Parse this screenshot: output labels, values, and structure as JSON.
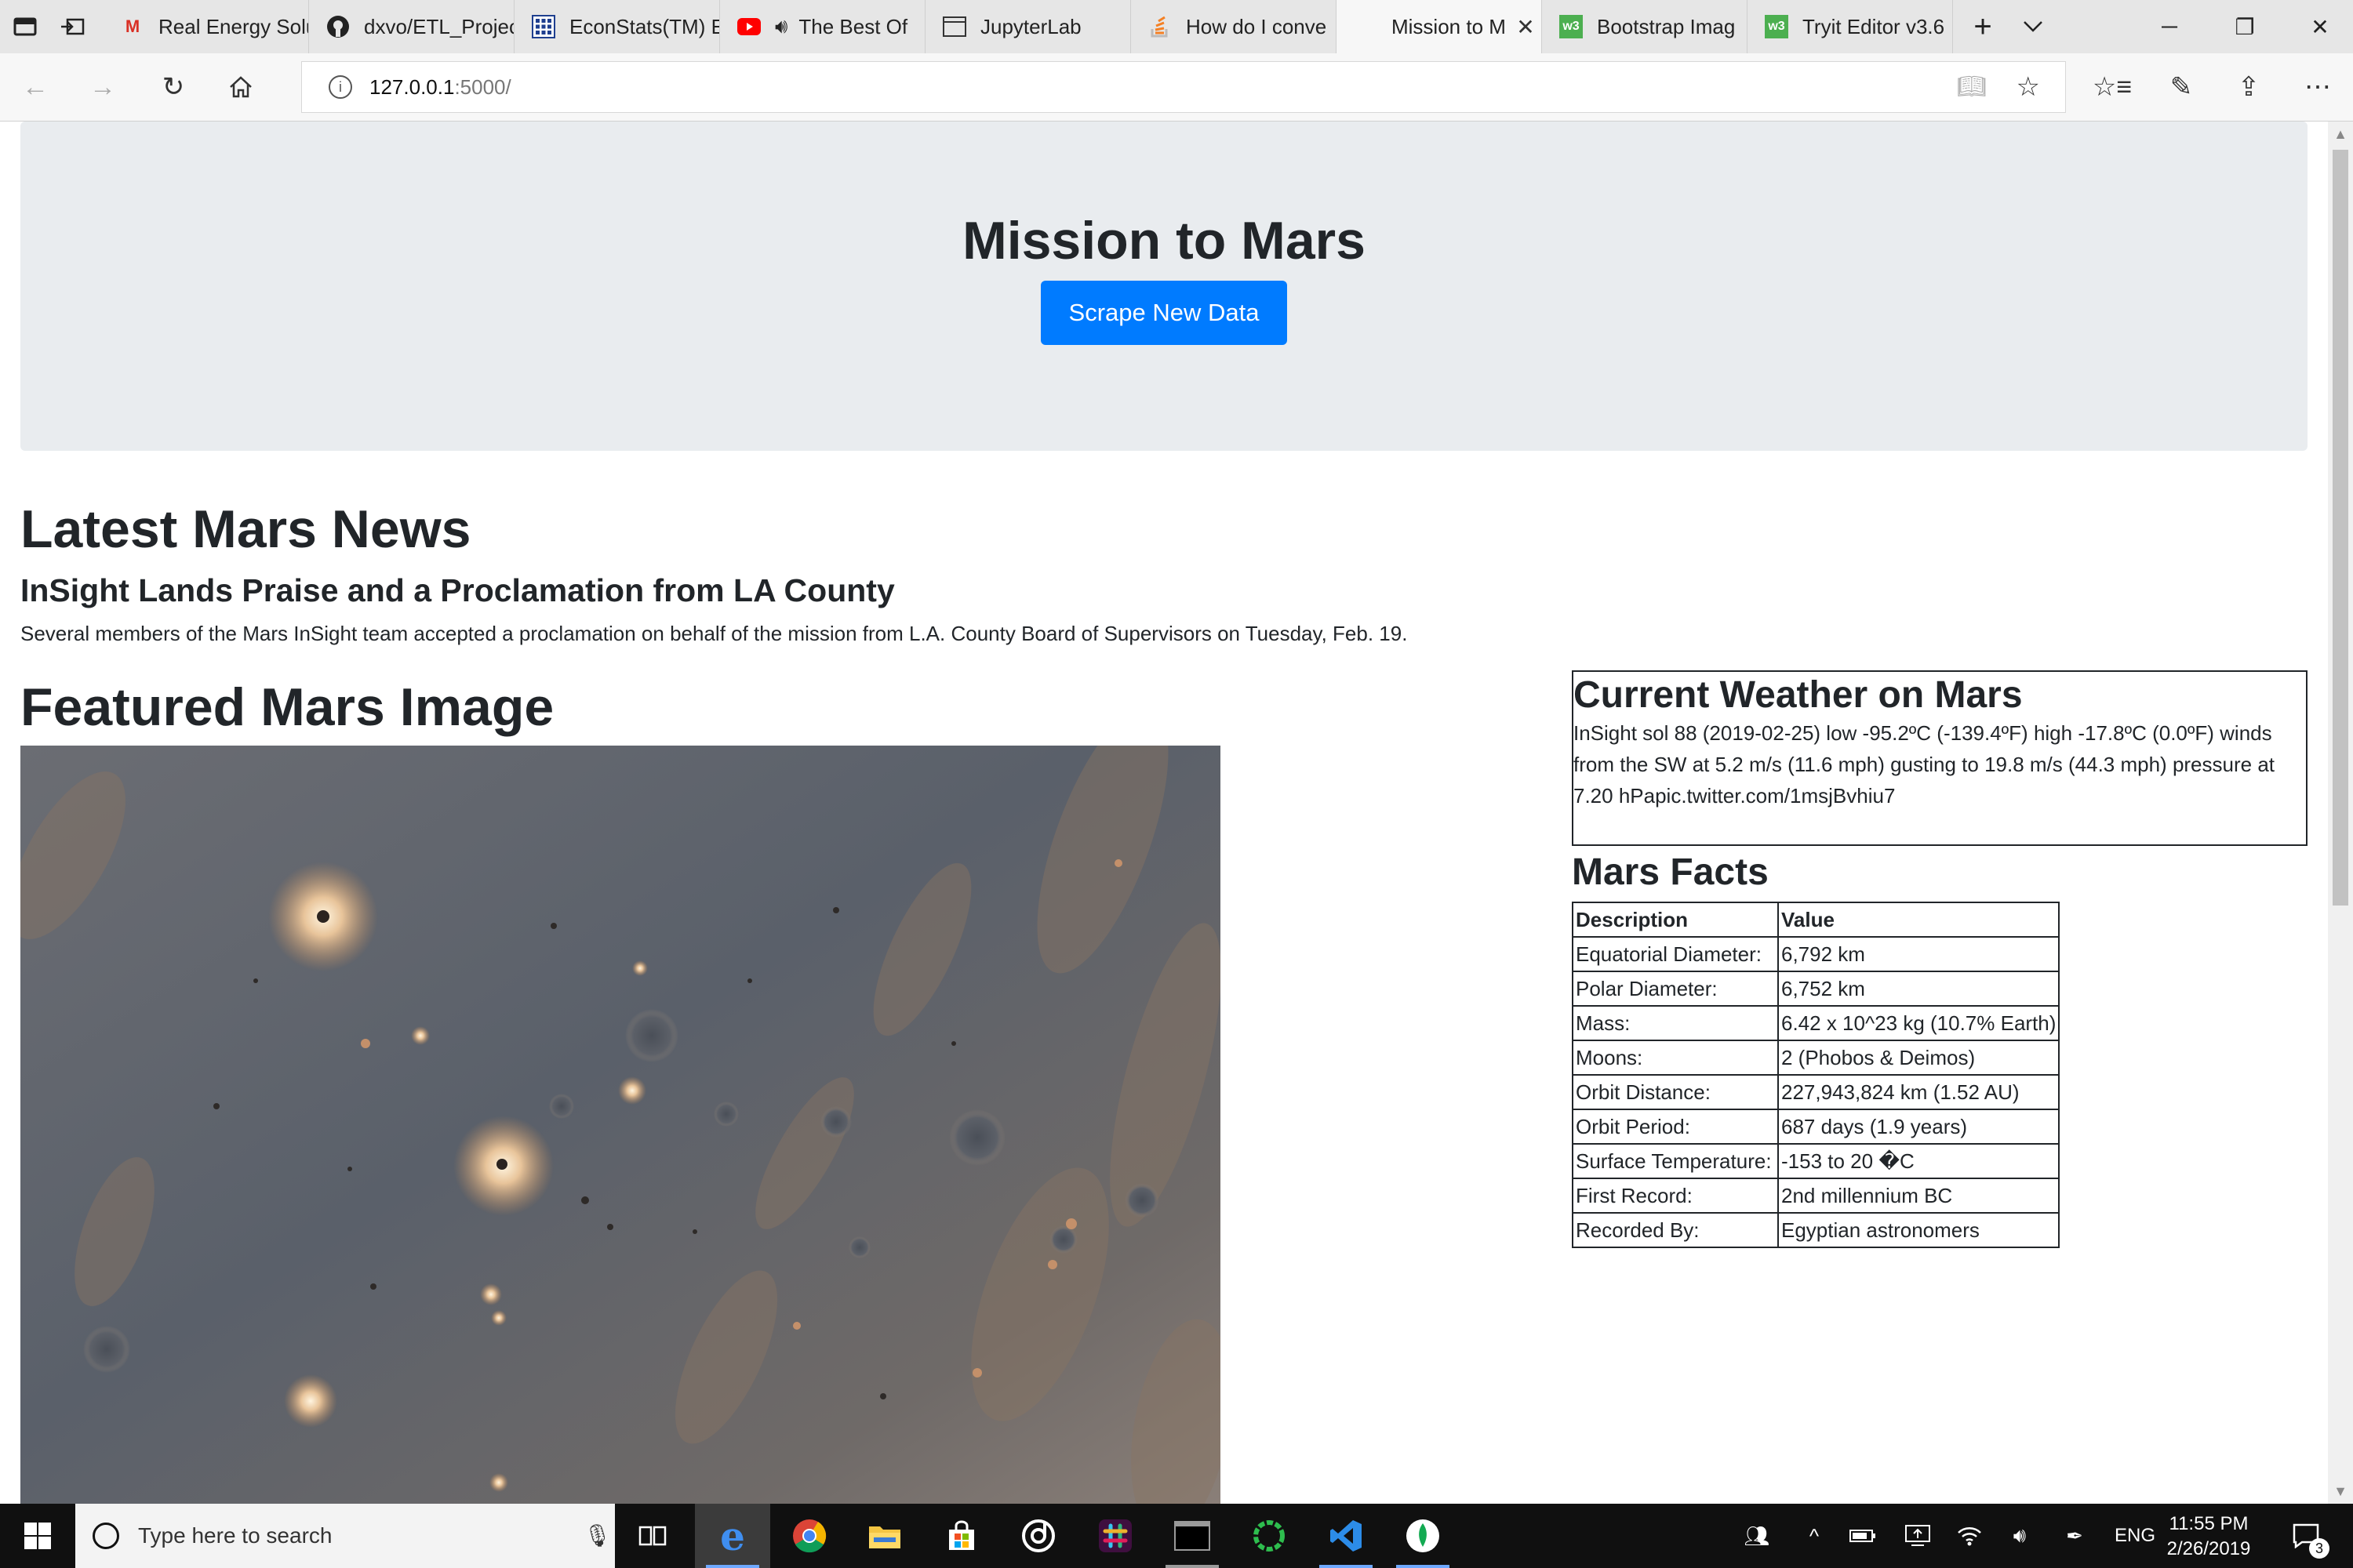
{
  "browser": {
    "tabs": [
      {
        "title": "Real Energy Solu",
        "favicon": "gmail-icon",
        "active": false
      },
      {
        "title": "dxvo/ETL_Projec",
        "favicon": "github-icon",
        "active": false
      },
      {
        "title": "EconStats(TM) E",
        "favicon": "econstats-icon",
        "active": false
      },
      {
        "title": "The Best Of",
        "favicon": "youtube-icon",
        "active": false,
        "audio": true
      },
      {
        "title": "JupyterLab",
        "favicon": "page-icon",
        "active": false
      },
      {
        "title": "How do I conve",
        "favicon": "stackoverflow-icon",
        "active": false
      },
      {
        "title": "Mission to M",
        "favicon": "none",
        "active": true
      },
      {
        "title": "Bootstrap Imag",
        "favicon": "w3schools-icon",
        "active": false
      },
      {
        "title": "Tryit Editor v3.6",
        "favicon": "w3schools-icon",
        "active": false
      }
    ],
    "url_host": "127.0.0.1",
    "url_path": ":5000/"
  },
  "page": {
    "title": "Mission to Mars",
    "scrape_button": "Scrape New Data",
    "news_heading": "Latest Mars News",
    "news_title": "InSight Lands Praise and a Proclamation from LA County",
    "news_teaser": "Several members of the Mars InSight team accepted a proclamation on behalf of the mission from L.A. County Board of Supervisors on Tuesday, Feb. 19.",
    "featured_heading": "Featured Mars Image",
    "weather_heading": "Current Weather on Mars",
    "weather_text": "InSight sol 88 (2019-02-25) low -95.2ºC (-139.4ºF) high -17.8ºC (0.0ºF) winds from the SW at 5.2 m/s (11.6 mph) gusting to 19.8 m/s (44.3 mph) pressure at 7.20 hPapic.twitter.com/1msjBvhiu7",
    "facts_heading": "Mars Facts",
    "facts_columns": [
      "Description",
      "Value"
    ],
    "facts_rows": [
      [
        "Equatorial Diameter:",
        "6,792 km"
      ],
      [
        "Polar Diameter:",
        "6,752 km"
      ],
      [
        "Mass:",
        "6.42 x 10^23 kg (10.7% Earth)"
      ],
      [
        "Moons:",
        "2 (Phobos & Deimos)"
      ],
      [
        "Orbit Distance:",
        "227,943,824 km (1.52 AU)"
      ],
      [
        "Orbit Period:",
        "687 days (1.9 years)"
      ],
      [
        "Surface Temperature:",
        "-153 to 20 �C"
      ],
      [
        "First Record:",
        "2nd millennium BC"
      ],
      [
        "Recorded By:",
        "Egyptian astronomers"
      ]
    ]
  },
  "taskbar": {
    "search_placeholder": "Type here to search",
    "language": "ENG",
    "time": "11:55 PM",
    "date": "2/26/2019",
    "notification_count": "3"
  },
  "colors": {
    "primary": "#007bff",
    "jumbotron": "#e9ecef",
    "text": "#212529",
    "taskbar": "#101010"
  }
}
